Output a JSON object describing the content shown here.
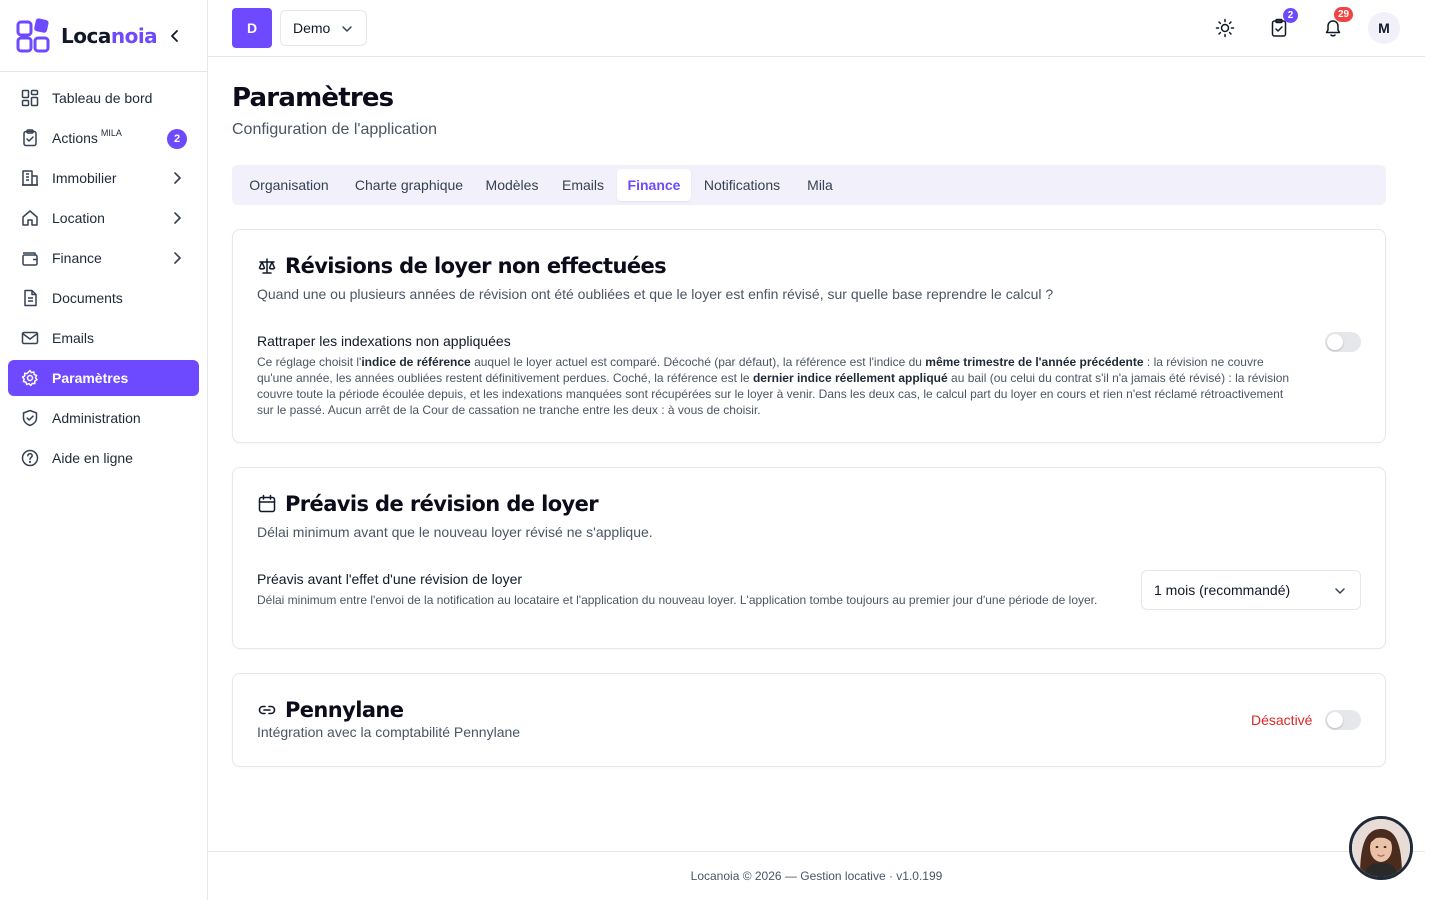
{
  "brand": {
    "name_prefix": "Loca",
    "name_suffix": "noia",
    "accent_color": "#6d4aff"
  },
  "sidebar": {
    "items": [
      {
        "label": "Tableau de bord",
        "icon": "dashboard-icon"
      },
      {
        "label": "Actions",
        "sup": "MILA",
        "badge": "2",
        "icon": "clipboard-check-icon"
      },
      {
        "label": "Immobilier",
        "icon": "building-icon",
        "has_children": true
      },
      {
        "label": "Location",
        "icon": "home-icon",
        "has_children": true
      },
      {
        "label": "Finance",
        "icon": "wallet-icon",
        "has_children": true
      },
      {
        "label": "Documents",
        "icon": "document-icon"
      },
      {
        "label": "Emails",
        "icon": "mail-icon"
      },
      {
        "label": "Paramètres",
        "icon": "gear-icon",
        "active": true
      },
      {
        "label": "Administration",
        "icon": "shield-check-icon"
      },
      {
        "label": "Aide en ligne",
        "icon": "help-circle-icon"
      }
    ]
  },
  "topbar": {
    "org_initial": "D",
    "org_name": "Demo",
    "tasks_badge": "2",
    "notifications_badge": "29",
    "user_initial": "M"
  },
  "page": {
    "title": "Paramètres",
    "subtitle": "Configuration de l'application"
  },
  "tabs": [
    {
      "label": "Organisation"
    },
    {
      "label": "Charte graphique"
    },
    {
      "label": "Modèles"
    },
    {
      "label": "Emails"
    },
    {
      "label": "Finance",
      "active": true
    },
    {
      "label": "Notifications"
    },
    {
      "label": "Mila"
    }
  ],
  "cards": {
    "revisions": {
      "title": "Révisions de loyer non effectuées",
      "description": "Quand une ou plusieurs années de révision ont été oubliées et que le loyer est enfin révisé, sur quelle base reprendre le calcul ?",
      "setting_label": "Rattraper les indexations non appliquées",
      "help": {
        "p1": "Ce réglage choisit l'",
        "b1": "indice de référence",
        "p2": " auquel le loyer actuel est comparé. Décoché (par défaut), la référence est l'indice du ",
        "b2": "même trimestre de l'année précédente",
        "p3": " : la révision ne couvre qu'une année, les années oubliées restent définitivement perdues. Coché, la référence est le ",
        "b3": "dernier indice réellement appliqué",
        "p4": " au bail (ou celui du contrat s'il n'a jamais été révisé) : la révision couvre toute la période écoulée depuis, et les indexations manquées sont récupérées sur le loyer à venir. Dans les deux cas, le calcul part du loyer en cours et rien n'est réclamé rétroactivement sur le passé. Aucun arrêt de la Cour de cassation ne tranche entre les deux : à vous de choisir."
      },
      "toggle_on": false
    },
    "preavis": {
      "title": "Préavis de révision de loyer",
      "description": "Délai minimum avant que le nouveau loyer révisé ne s'applique.",
      "setting_label": "Préavis avant l'effet d'une révision de loyer",
      "help": "Délai minimum entre l'envoi de la notification au locataire et l'application du nouveau loyer. L'application tombe toujours au premier jour d'une période de loyer.",
      "selected": "1 mois (recommandé)"
    },
    "pennylane": {
      "title": "Pennylane",
      "description": "Intégration avec la comptabilité Pennylane",
      "status": "Désactivé",
      "status_color": "#dc2626",
      "toggle_on": false
    }
  },
  "footer": {
    "text": "Locanoia © 2026 — Gestion locative · v1.0.199"
  }
}
